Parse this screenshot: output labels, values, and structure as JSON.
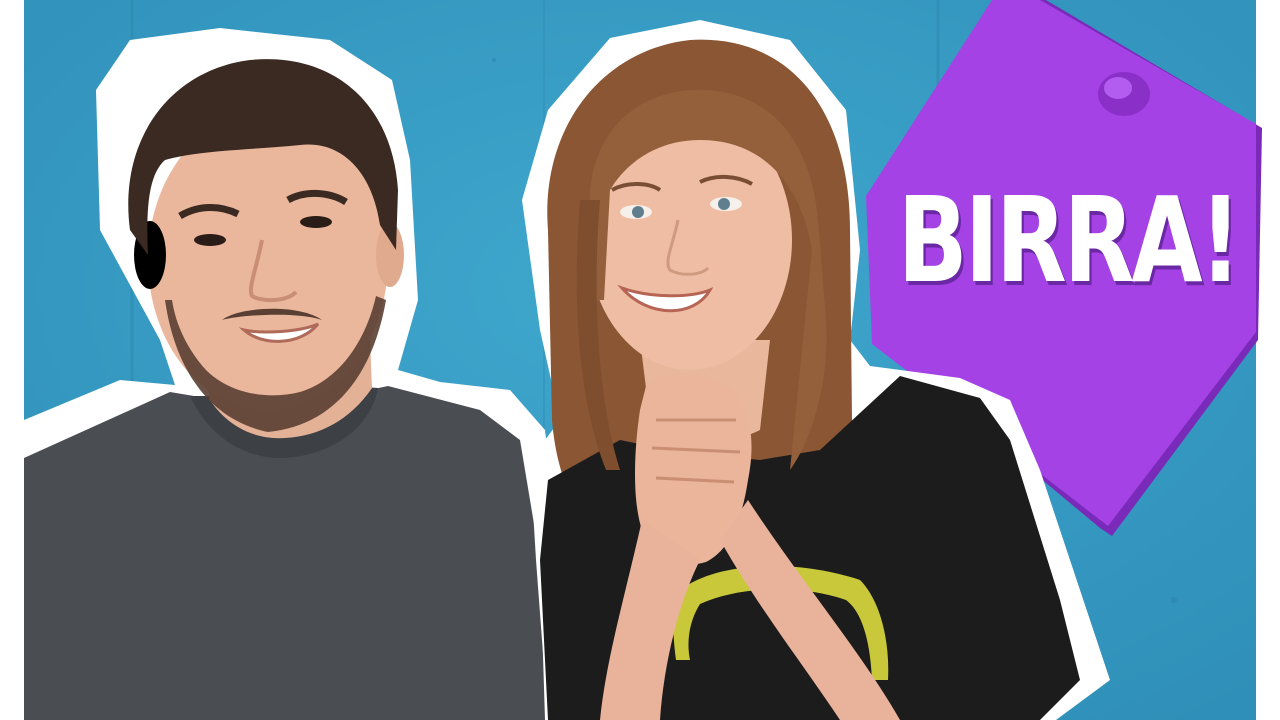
{
  "thumbnail": {
    "sticky_note": {
      "text": "BIRRA!",
      "color": "#a040e0"
    },
    "colors": {
      "background_wall": "#3a9cc4",
      "cutout_border": "#ffffff",
      "man_shirt": "#4a4d52",
      "woman_shirt": "#1c1c1c",
      "shirt_logo": "#c8c83a"
    }
  }
}
